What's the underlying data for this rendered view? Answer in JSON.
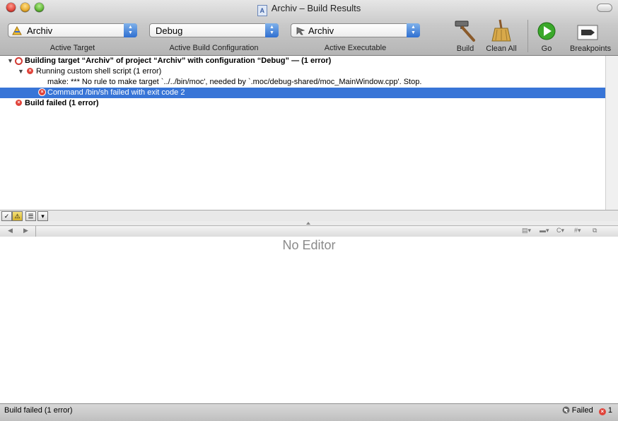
{
  "window": {
    "title": "Archiv – Build Results"
  },
  "toolbar": {
    "active_target": {
      "value": "Archiv",
      "label": "Active Target"
    },
    "active_build_configuration": {
      "value": "Debug",
      "label": "Active Build Configuration"
    },
    "active_executable": {
      "value": "Archiv",
      "label": "Active Executable"
    },
    "build_label": "Build",
    "clean_all_label": "Clean All",
    "go_label": "Go",
    "breakpoints_label": "Breakpoints"
  },
  "results": {
    "rows": [
      {
        "text": "Building target “Archiv” of project “Archiv” with configuration “Debug” — (1 error)"
      },
      {
        "text": "Running custom shell script (1 error)"
      },
      {
        "text": "make: *** No rule to make target `../../bin/moc', needed by `.moc/debug-shared/moc_MainWindow.cpp'.  Stop."
      },
      {
        "text": "Command /bin/sh failed with exit code 2"
      },
      {
        "text": "Build failed (1 error)"
      }
    ]
  },
  "editor": {
    "placeholder": "No Editor"
  },
  "status": {
    "left_text": "Build failed (1 error)",
    "right_text": "Failed",
    "error_count": "1"
  },
  "colors": {
    "selection": "#3875d7",
    "error": "#e0433a",
    "go_green": "#3aa82a"
  }
}
